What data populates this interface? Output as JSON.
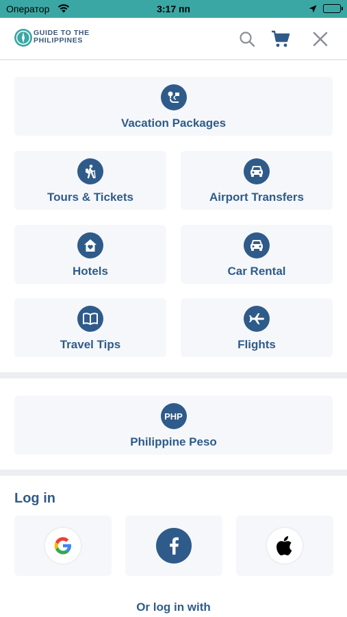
{
  "status_bar": {
    "carrier": "Оператор",
    "time": "3:17 пп"
  },
  "header": {
    "logo_line1": "GUIDE TO THE",
    "logo_line2": "PHILIPPINES",
    "icons": [
      "search-icon",
      "cart-icon",
      "close-icon"
    ]
  },
  "menu": {
    "vacation_packages": "Vacation Packages",
    "tours_tickets": "Tours & Tickets",
    "airport_transfers": "Airport Transfers",
    "hotels": "Hotels",
    "car_rental": "Car Rental",
    "travel_tips": "Travel Tips",
    "flights": "Flights"
  },
  "currency": {
    "code": "PHP",
    "label": "Philippine Peso"
  },
  "login": {
    "title": "Log in",
    "providers": [
      "Google",
      "Facebook",
      "Apple"
    ],
    "or_login_with": "Or log in with"
  },
  "colors": {
    "status_bar": "#3aa7a4",
    "primary": "#2f5b8a",
    "tile_bg": "#f5f7fa",
    "divider": "#eceef2"
  }
}
